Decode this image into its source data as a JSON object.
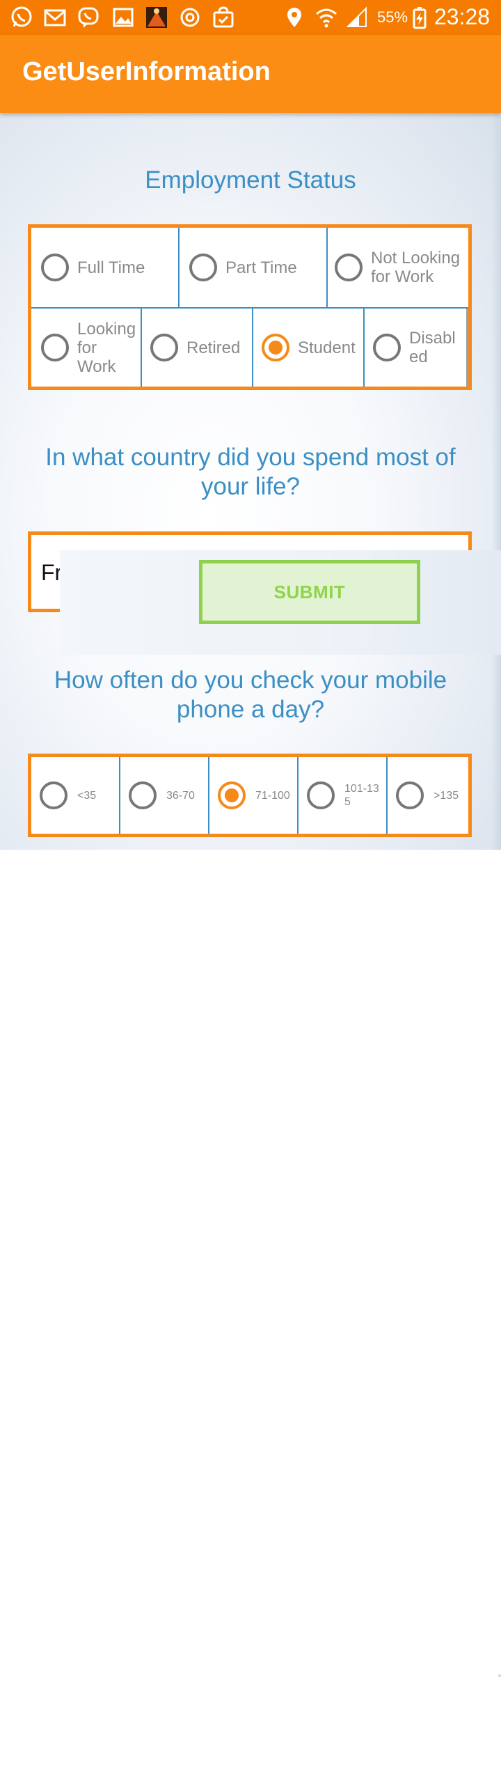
{
  "status_bar": {
    "left_icons": [
      "whatsapp-icon",
      "gmail-icon",
      "viber-icon",
      "gallery-icon",
      "game-icon",
      "sync-icon",
      "store-bag-icon"
    ],
    "right_icons": [
      "location-icon",
      "wifi-icon",
      "signal-icon",
      "battery-charging-icon"
    ],
    "battery_percent": "55%",
    "time": "23:28",
    "bg_color": "#f57c00"
  },
  "app_bar": {
    "title": "GetUserInformation",
    "bg_color": "#fb8c14"
  },
  "employment": {
    "question": "Employment Status",
    "options": [
      {
        "label": "Full Time",
        "checked": false
      },
      {
        "label": "Part Time",
        "checked": false
      },
      {
        "label": "Not Looking for Work",
        "checked": false
      },
      {
        "label": "Looking for Work",
        "checked": false
      },
      {
        "label": "Retired",
        "checked": false
      },
      {
        "label": "Student",
        "checked": true
      },
      {
        "label": "Disabled",
        "checked": false
      }
    ]
  },
  "country": {
    "question": "In what country did you spend most of your life?",
    "input_value": "Fr"
  },
  "submit": {
    "label": "SUBMIT"
  },
  "phone_check": {
    "question": "How often do you check your mobile phone a day?",
    "options": [
      {
        "label": "<35",
        "checked": false
      },
      {
        "label": "36-70",
        "checked": false
      },
      {
        "label": "71-100",
        "checked": true
      },
      {
        "label": "101-135",
        "checked": false
      },
      {
        "label": ">135",
        "checked": false
      }
    ]
  },
  "colors": {
    "accent_orange": "#f58a1a",
    "question_blue": "#3b8fc4",
    "submit_green": "#8ed14f"
  }
}
